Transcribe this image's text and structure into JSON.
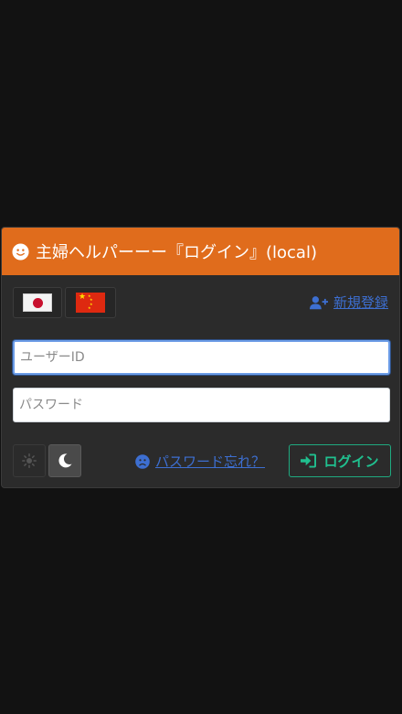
{
  "header": {
    "title": "主婦ヘルパーーー『ログイン』(local)",
    "icon": "smile-icon"
  },
  "languages": [
    {
      "name": "japanese",
      "icon": "japan-flag-icon"
    },
    {
      "name": "chinese",
      "icon": "china-flag-icon"
    }
  ],
  "register": {
    "label": " 新規登録",
    "icon": "user-plus-icon"
  },
  "form": {
    "user_id_placeholder": "ユーザーID",
    "password_placeholder": "パスワード",
    "user_id_value": "",
    "password_value": ""
  },
  "theme": {
    "light_icon": "sun-icon",
    "dark_icon": "moon-icon",
    "selected": "dark"
  },
  "forgot": {
    "label": " パスワード忘れ？",
    "icon": "sad-face-icon"
  },
  "login": {
    "label": "ログイン",
    "icon": "sign-in-icon"
  },
  "colors": {
    "header_bg": "#e06c1c",
    "card_bg": "#2b2b2b",
    "page_bg": "#121212",
    "link": "#3d6fd1",
    "login_accent": "#20c08f"
  }
}
